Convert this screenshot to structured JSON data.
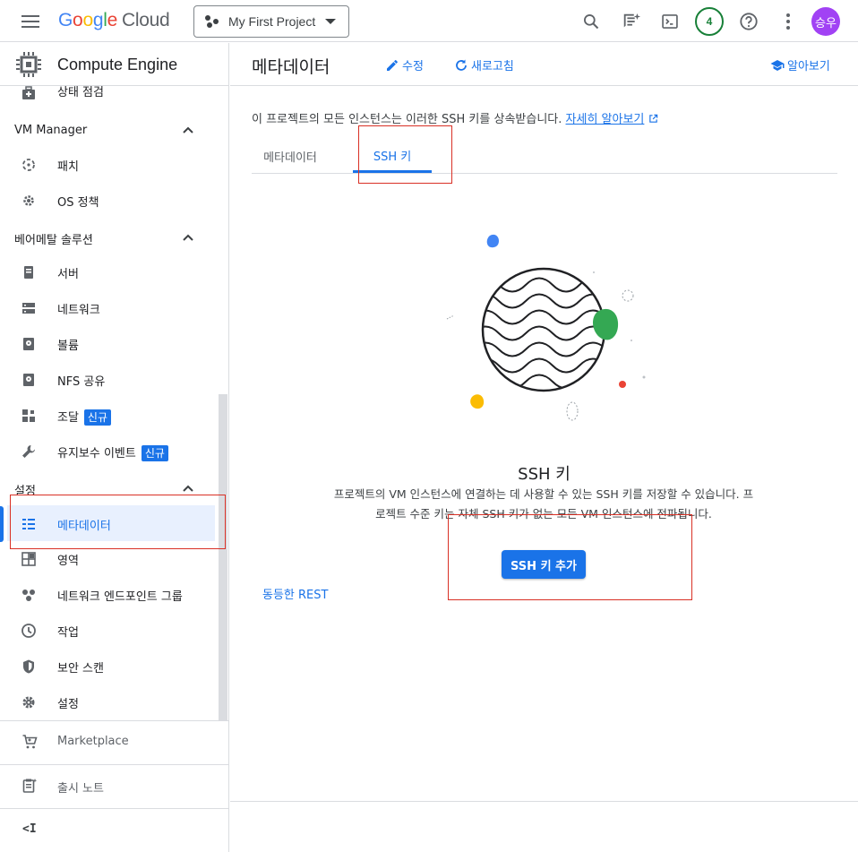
{
  "topbar": {
    "logo_letters": [
      "G",
      "o",
      "o",
      "g",
      "l",
      "e"
    ],
    "logo_cloud": "Cloud",
    "project_name": "My First Project",
    "notification_count": "4",
    "avatar_initials": "승우"
  },
  "sidebar": {
    "product_title": "Compute Engine",
    "partial_item": "상태 점검",
    "sections": {
      "vm_manager": "VM Manager",
      "baremetal": "베어메탈 솔루션",
      "settings": "설정"
    },
    "items": {
      "patch": "패치",
      "os_policy": "OS 정책",
      "server": "서버",
      "network": "네트워크",
      "volume": "볼륨",
      "nfs": "NFS 공유",
      "procurement": "조달",
      "maintenance": "유지보수 이벤트",
      "metadata": "메타데이터",
      "zones": "영역",
      "neg": "네트워크 엔드포인트 그룹",
      "operations": "작업",
      "security_scan": "보안 스캔",
      "settings": "설정"
    },
    "new_badge": "신규",
    "bottom": {
      "marketplace": "Marketplace",
      "release_notes": "출시 노트",
      "collapse": "<I"
    }
  },
  "main": {
    "title": "메타데이터",
    "edit_label": "수정",
    "refresh_label": "새로고침",
    "learn_label": "알아보기",
    "info_text": "이 프로젝트의 모든 인스턴스는 이러한 SSH 키를 상속받습니다.",
    "info_link": "자세히 알아보기",
    "tabs": [
      "메타데이터",
      "SSH 키"
    ],
    "empty_title": "SSH 키",
    "empty_desc": "프로젝트의 VM 인스턴스에 연결하는 데 사용할 수 있는 SSH 키를 저장할 수 있습니다. 프로젝트 수준 키는 자체 SSH 키가 없는 모든 VM 인스턴스에 전파됩니다.",
    "add_button": "SSH 키 추가",
    "rest_link": "동등한 REST"
  },
  "colors": {
    "accent": "#1a73e8",
    "highlight_box": "#d93025",
    "avatar": "#a142f4",
    "badge_ring": "#188038"
  }
}
